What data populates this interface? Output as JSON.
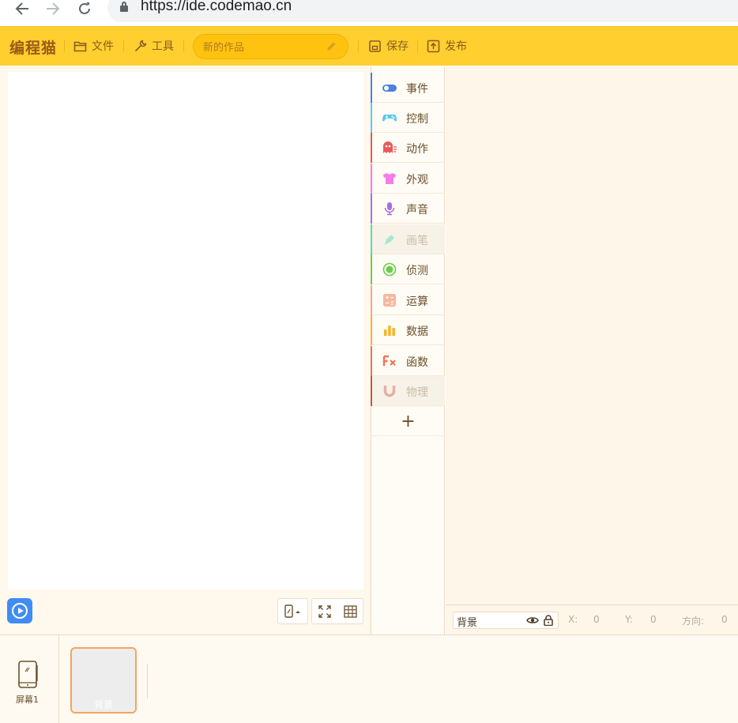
{
  "browser": {
    "url": "https://ide.codemao.cn"
  },
  "toolbar": {
    "logo": "编程猫",
    "file_label": "文件",
    "tools_label": "工具",
    "title_placeholder": "新的作品",
    "save_label": "保存",
    "publish_label": "发布",
    "bar_color": "#fecf2f"
  },
  "categories": [
    {
      "label": "事件",
      "icon": "toggle-icon",
      "color": "#4c7fe0",
      "disabled": false
    },
    {
      "label": "控制",
      "icon": "gamepad-icon",
      "color": "#5cc9ee",
      "disabled": false
    },
    {
      "label": "动作",
      "icon": "ghost-icon",
      "color": "#e8585a",
      "disabled": false
    },
    {
      "label": "外观",
      "icon": "tshirt-icon",
      "color": "#f07ee8",
      "disabled": false
    },
    {
      "label": "声音",
      "icon": "microphone-icon",
      "color": "#a56fe4",
      "disabled": false
    },
    {
      "label": "画笔",
      "icon": "brush-icon",
      "color": "#5ed6b4",
      "disabled": true
    },
    {
      "label": "侦测",
      "icon": "radar-icon",
      "color": "#6ccd4a",
      "disabled": false
    },
    {
      "label": "运算",
      "icon": "calculator-icon",
      "color": "#f7a98a",
      "disabled": false
    },
    {
      "label": "数据",
      "icon": "bar-chart-icon",
      "color": "#f7b52b",
      "disabled": false
    },
    {
      "label": "函数",
      "icon": "function-icon",
      "color": "#ef7257",
      "disabled": false
    },
    {
      "label": "物理",
      "icon": "magnet-icon",
      "color": "#c0584a",
      "disabled": true
    }
  ],
  "add_category": "+",
  "props": {
    "sprite_name": "背景",
    "x_label": "X:",
    "x_value": "0",
    "y_label": "Y:",
    "y_value": "0",
    "direction_label": "方向:",
    "direction_value": "0"
  },
  "bottom": {
    "screen_label": "屏幕1",
    "background_label": "背景"
  }
}
